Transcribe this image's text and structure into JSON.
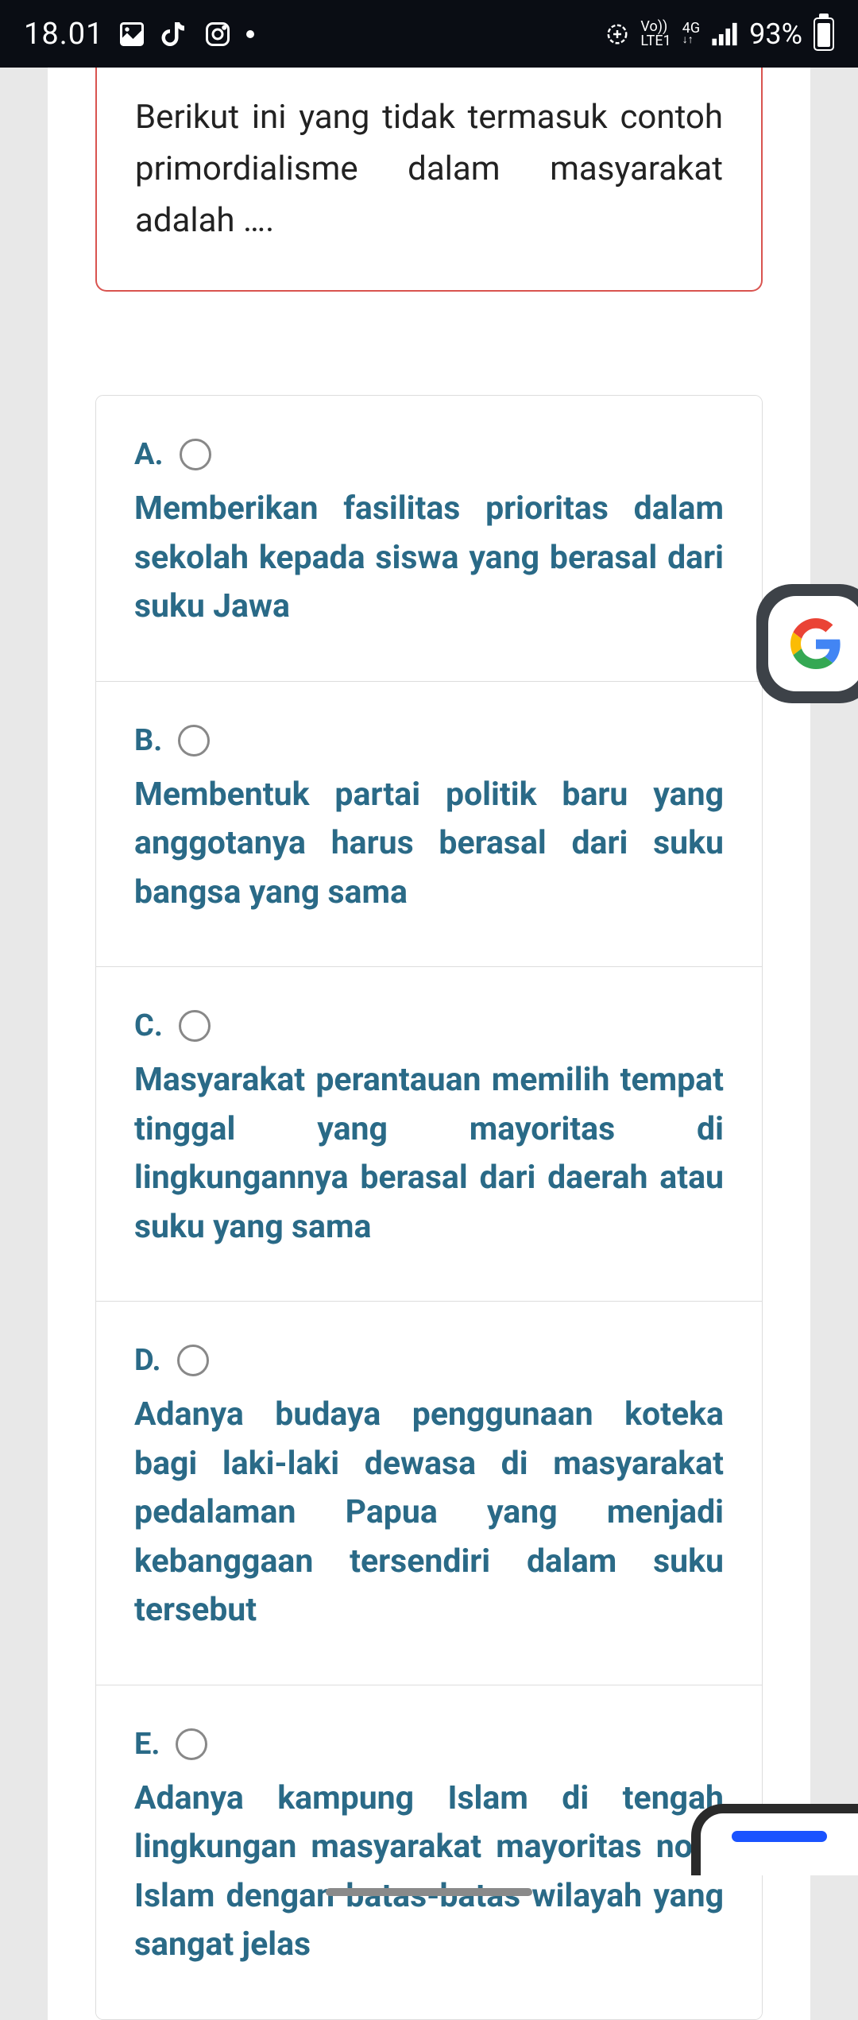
{
  "status": {
    "time": "18.01",
    "net_top": "Vo))",
    "net_bottom": "LTE1",
    "net_gen": "4G",
    "battery_pct": "93%"
  },
  "question": {
    "text": "Berikut ini yang tidak termasuk contoh primordialisme dalam masyarakat adalah …."
  },
  "options": [
    {
      "letter": "A.",
      "text": "Memberikan fasilitas prioritas dalam sekolah kepada siswa yang berasal dari suku Jawa"
    },
    {
      "letter": "B.",
      "text": "Membentuk partai politik baru yang anggotanya harus berasal dari suku bangsa yang sama"
    },
    {
      "letter": "C.",
      "text": "Masyarakat perantauan memilih tempat tinggal yang mayoritas di lingkungannya berasal dari daerah atau suku yang sama"
    },
    {
      "letter": "D.",
      "text": "Adanya budaya penggunaan koteka bagi laki-laki dewasa di masyarakat pedalaman Papua yang menjadi kebanggaan tersendiri dalam suku tersebut"
    },
    {
      "letter": "E.",
      "text": "Adanya kampung Islam di tengah lingkungan masyarakat mayoritas non-Islam dengan batas-batas wilayah yang sangat jelas"
    }
  ]
}
